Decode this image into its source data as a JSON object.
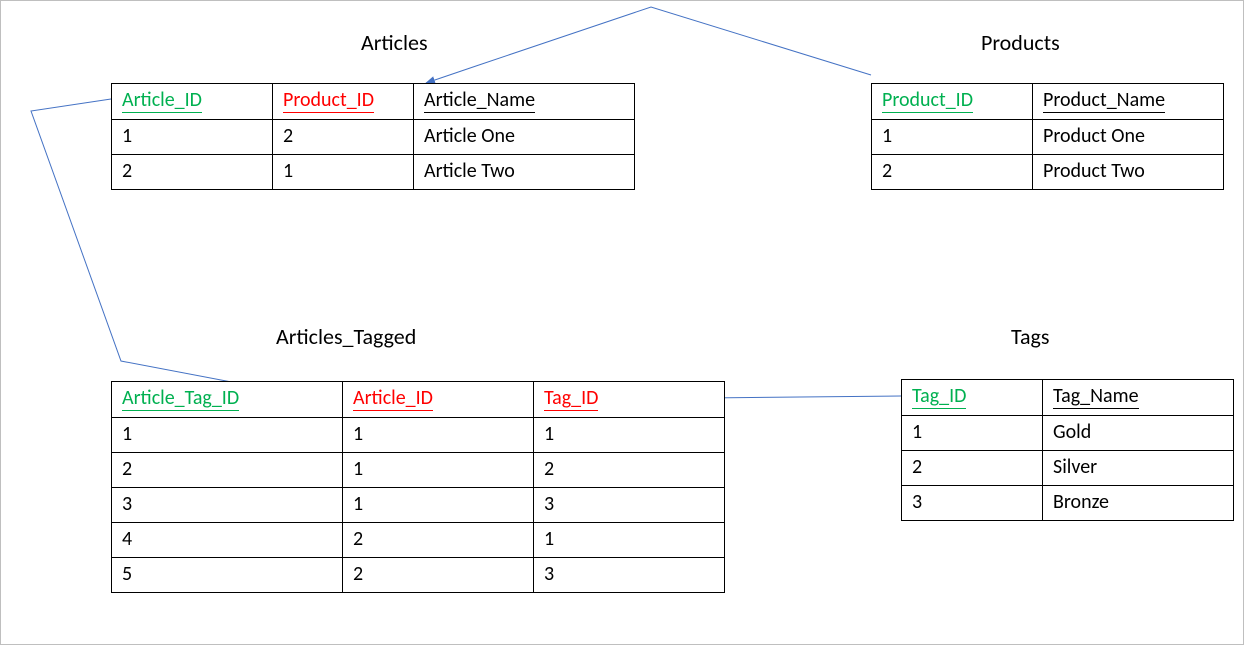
{
  "titles": {
    "articles": "Articles",
    "products": "Products",
    "articles_tagged": "Articles_Tagged",
    "tags": "Tags"
  },
  "tables": {
    "articles": {
      "columns": {
        "c0": "Article_ID",
        "c1": "Product_ID",
        "c2": "Article_Name"
      },
      "rows": [
        {
          "c0": "1",
          "c1": "2",
          "c2": "Article One"
        },
        {
          "c0": "2",
          "c1": "1",
          "c2": "Article Two"
        }
      ]
    },
    "products": {
      "columns": {
        "c0": "Product_ID",
        "c1": "Product_Name"
      },
      "rows": [
        {
          "c0": "1",
          "c1": "Product One"
        },
        {
          "c0": "2",
          "c1": "Product Two"
        }
      ]
    },
    "articles_tagged": {
      "columns": {
        "c0": "Article_Tag_ID",
        "c1": "Article_ID",
        "c2": "Tag_ID"
      },
      "rows": [
        {
          "c0": "1",
          "c1": "1",
          "c2": "1"
        },
        {
          "c0": "2",
          "c1": "1",
          "c2": "2"
        },
        {
          "c0": "3",
          "c1": "1",
          "c2": "3"
        },
        {
          "c0": "4",
          "c1": "2",
          "c2": "1"
        },
        {
          "c0": "5",
          "c1": "2",
          "c2": "3"
        }
      ]
    },
    "tags": {
      "columns": {
        "c0": "Tag_ID",
        "c1": "Tag_Name"
      },
      "rows": [
        {
          "c0": "1",
          "c1": "Gold"
        },
        {
          "c0": "2",
          "c1": "Silver"
        },
        {
          "c0": "3",
          "c1": "Bronze"
        }
      ]
    }
  },
  "chart_data": {
    "type": "table",
    "description": "Entity-relationship diagram with four tables and three foreign-key arrows",
    "tables": [
      {
        "name": "Articles",
        "columns": [
          {
            "name": "Article_ID",
            "role": "pk"
          },
          {
            "name": "Product_ID",
            "role": "fk",
            "references": "Products.Product_ID"
          },
          {
            "name": "Article_Name",
            "role": "attr"
          }
        ],
        "rows": [
          [
            1,
            2,
            "Article One"
          ],
          [
            2,
            1,
            "Article Two"
          ]
        ]
      },
      {
        "name": "Products",
        "columns": [
          {
            "name": "Product_ID",
            "role": "pk"
          },
          {
            "name": "Product_Name",
            "role": "attr"
          }
        ],
        "rows": [
          [
            1,
            "Product One"
          ],
          [
            2,
            "Product Two"
          ]
        ]
      },
      {
        "name": "Articles_Tagged",
        "columns": [
          {
            "name": "Article_Tag_ID",
            "role": "pk"
          },
          {
            "name": "Article_ID",
            "role": "fk",
            "references": "Articles.Article_ID"
          },
          {
            "name": "Tag_ID",
            "role": "fk",
            "references": "Tags.Tag_ID"
          }
        ],
        "rows": [
          [
            1,
            1,
            1
          ],
          [
            2,
            1,
            2
          ],
          [
            3,
            1,
            3
          ],
          [
            4,
            2,
            1
          ],
          [
            5,
            2,
            3
          ]
        ]
      },
      {
        "name": "Tags",
        "columns": [
          {
            "name": "Tag_ID",
            "role": "pk"
          },
          {
            "name": "Tag_Name",
            "role": "attr"
          }
        ],
        "rows": [
          [
            1,
            "Gold"
          ],
          [
            2,
            "Silver"
          ],
          [
            3,
            "Bronze"
          ]
        ]
      }
    ],
    "relationships": [
      {
        "from": "Articles.Product_ID",
        "to": "Products.Product_ID"
      },
      {
        "from": "Articles_Tagged.Article_ID",
        "to": "Articles.Article_ID"
      },
      {
        "from": "Articles_Tagged.Tag_ID",
        "to": "Tags.Tag_ID"
      }
    ]
  }
}
